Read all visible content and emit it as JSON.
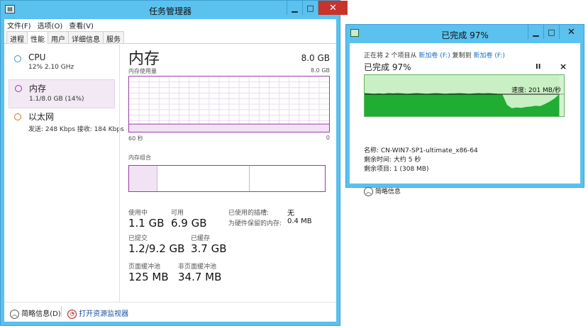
{
  "task_manager": {
    "title": "任务管理器",
    "menu": [
      "文件(F)",
      "选项(O)",
      "查看(V)"
    ],
    "tabs": [
      "进程",
      "性能",
      "用户",
      "详细信息",
      "服务"
    ],
    "active_tab": 1,
    "sidebar": [
      {
        "title": "CPU",
        "sub": "12% 2.10 GHz",
        "ring": "blue"
      },
      {
        "title": "内存",
        "sub": "1.1/8.0 GB (14%)",
        "ring": "purple",
        "selected": true
      },
      {
        "title": "以太网",
        "sub": "发送: 248 Kbps 接收: 184 Kbps",
        "ring": "orange"
      }
    ],
    "memory": {
      "heading": "内存",
      "total": "8.0 GB",
      "usage_label": "内存使用量",
      "usage_max": "8.0 GB",
      "time_left": "60 秒",
      "time_right": "0",
      "composition_label": "内存组合",
      "used_fraction": 0.14
    },
    "stats": {
      "in_use_label": "使用中",
      "in_use": "1.1 GB",
      "available_label": "可用",
      "available": "6.9 GB",
      "committed_label": "已提交",
      "committed": "1.2/9.2 GB",
      "cached_label": "已缓存",
      "cached": "3.7 GB",
      "paged_label": "页面缓冲池",
      "paged": "125 MB",
      "nonpaged_label": "非页面缓冲池",
      "nonpaged": "34.7 MB",
      "slots_label": "已使用的插槽:",
      "slots": "无",
      "reserved_label": "为硬件保留的内存:",
      "reserved": "0.4 MB"
    },
    "footer": {
      "fewer_details": "简略信息(D)",
      "resource_monitor": "打开资源监视器"
    }
  },
  "copy_dialog": {
    "title": "已完成 97%",
    "line_prefix": "正在将 2 个项目从",
    "source": "新加卷 (F:)",
    "line_mid": "复制到",
    "dest": "新加卷 (F:)",
    "percent_text": "已完成 97%",
    "pause_label": "II",
    "cancel_label": "×",
    "speed": "速度: 201 MB/秒",
    "name_label": "名称: CN-WIN7-SP1-ultimate_x86-64",
    "time_left": "剩余时间: 大约 5 秒",
    "items_left": "剩余项目: 1 (308 MB)",
    "fewer_details": "简略信息",
    "progress": 0.97
  },
  "colors": {
    "window_frame": "#5bc1ee",
    "memory_accent": "#9b3aa9",
    "copy_fill": "#1fad33",
    "copy_bg": "#c9f0c4",
    "close_red": "#c7342b"
  }
}
